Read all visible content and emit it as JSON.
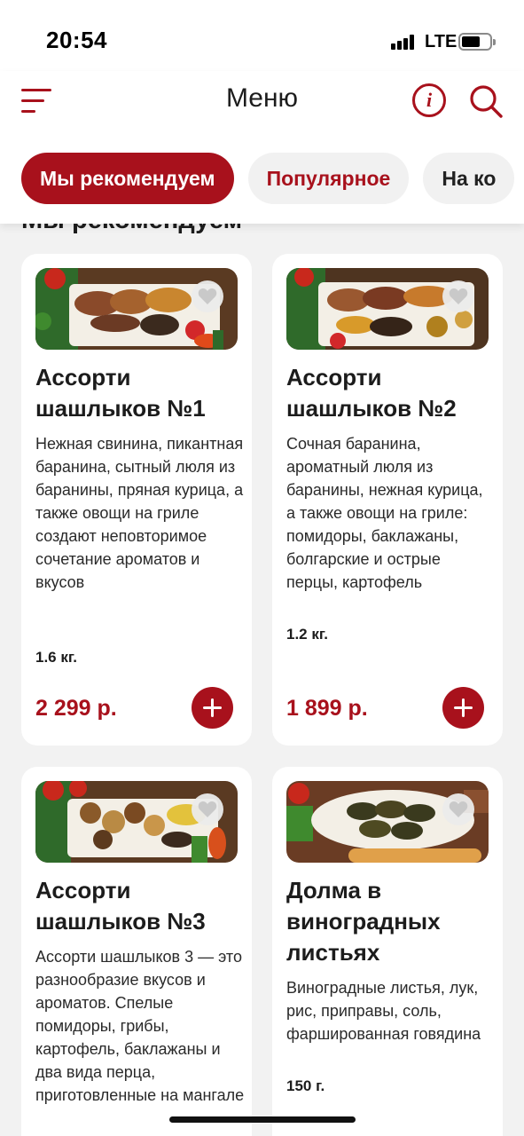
{
  "status_bar": {
    "time": "20:54",
    "network": "LTE"
  },
  "header": {
    "title": "Меню"
  },
  "tabs": [
    {
      "label": "Мы рекомендуем",
      "active": true
    },
    {
      "label": "Популярное",
      "active": false
    },
    {
      "label": "На ко",
      "active": false
    }
  ],
  "section": {
    "title": "Мы рекомендуем"
  },
  "products": [
    {
      "name": "Ассорти шашлыков №1",
      "description": "Нежная свинина, пикантная баранина, сытный люля из баранины, пряная курица, а также овощи на гриле создают неповторимое сочетание ароматов и вкусов",
      "weight": "1.6 кг.",
      "price": "2 299 р."
    },
    {
      "name": "Ассорти шашлыков №2",
      "description": "Сочная баранина, ароматный люля из баранины, нежная курица, а также овощи на гриле: помидоры, баклажаны, болгарские и острые перцы, картофель",
      "weight": "1.2 кг.",
      "price": "1 899 р."
    },
    {
      "name": "Ассорти шашлыков №3",
      "description": "Ассорти шашлыков 3 — это разнообразие вкусов и ароматов. Спелые помидоры, грибы, картофель, баклажаны и два вида перца, приготовленные на мангале"
    },
    {
      "name": "Долма в виноградных листьях",
      "description": "Виноградные листья, лук, рис, приправы, соль, фаршированная говядина",
      "weight": "150 г."
    }
  ],
  "colors": {
    "accent": "#a8111c",
    "background": "#f2f2f2",
    "tab_idle": "#f1f1f1"
  },
  "icons": [
    "menu-icon",
    "info-icon",
    "search-icon",
    "heart-icon",
    "plus-icon"
  ]
}
